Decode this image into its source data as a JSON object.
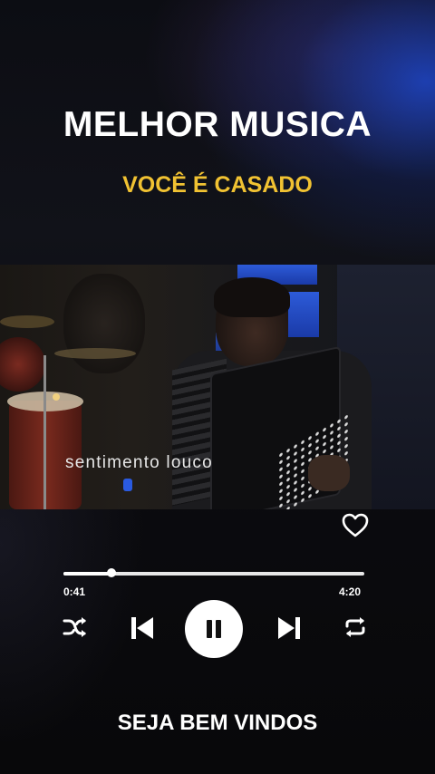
{
  "header": {
    "title": "MELHOR MUSICA",
    "subtitle": "VOCÊ É CASADO"
  },
  "video": {
    "lyric_overlay": "sentimento louco"
  },
  "player": {
    "current_time": "0:41",
    "total_time": "4:20",
    "progress": 0.16,
    "state": "playing",
    "icons": [
      "heart-icon",
      "shuffle-icon",
      "previous-icon",
      "pause-icon",
      "next-icon",
      "repeat-icon"
    ]
  },
  "footer": {
    "text": "SEJA BEM VINDOS"
  },
  "colors": {
    "subtitle": "#f1c232",
    "text": "#ffffff",
    "accent_blue": "#2d5bd8"
  }
}
